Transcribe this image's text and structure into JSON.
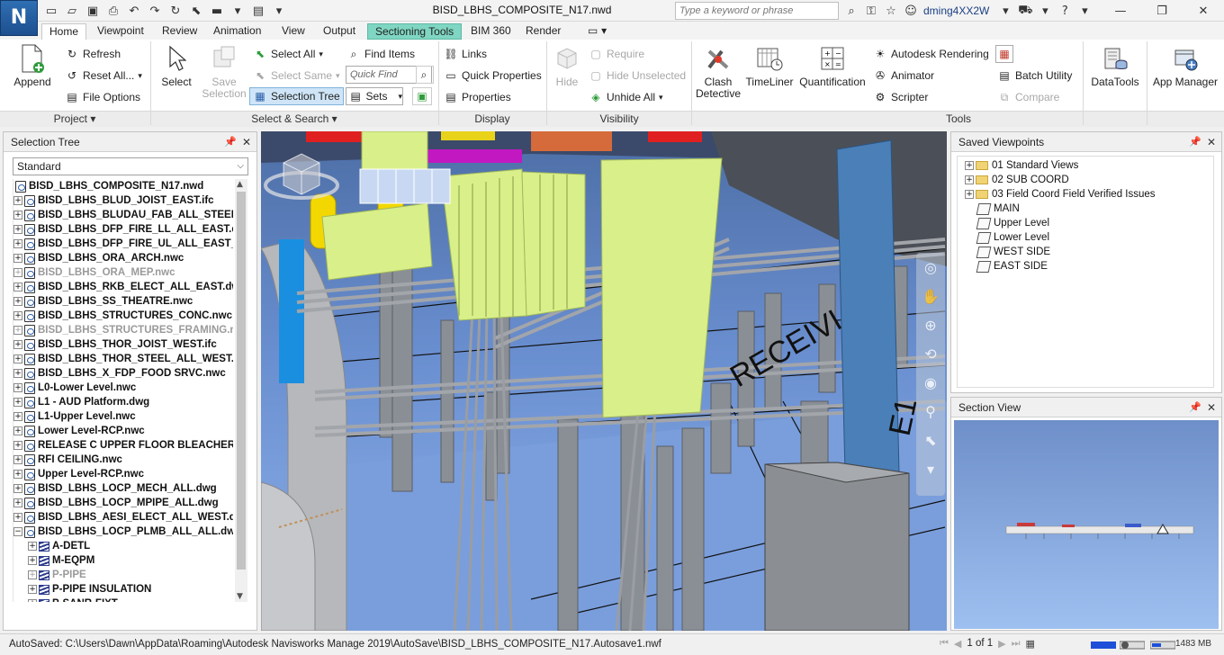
{
  "app": {
    "logo_letter": "N",
    "window_title": "BISD_LBHS_COMPOSITE_N17.nwd",
    "search_placeholder": "Type a keyword or phrase",
    "username": "dming4XX2W"
  },
  "ribbon_tabs": [
    "Home",
    "Viewpoint",
    "Review",
    "Animation",
    "View",
    "Output",
    "Sectioning Tools",
    "BIM 360",
    "Render"
  ],
  "active_tab": "Home",
  "ribbon": {
    "project": {
      "label": "Project",
      "append": "Append",
      "refresh": "Refresh",
      "reset_all": "Reset All...",
      "file_options": "File Options"
    },
    "select_search": {
      "label": "Select & Search",
      "select": "Select",
      "save_selection_1": "Save",
      "save_selection_2": "Selection",
      "select_all": "Select All",
      "select_same": "Select Same",
      "selection_tree": "Selection Tree",
      "find_items": "Find Items",
      "quick_find_placeholder": "Quick Find",
      "sets": "Sets"
    },
    "display": {
      "label": "Display",
      "links": "Links",
      "quick_properties": "Quick Properties",
      "properties": "Properties"
    },
    "visibility": {
      "label": "Visibility",
      "hide": "Hide",
      "require": "Require",
      "hide_unselected": "Hide Unselected",
      "unhide_all": "Unhide All"
    },
    "tools": {
      "label": "Tools",
      "clash_1": "Clash",
      "clash_2": "Detective",
      "timeliner": "TimeLiner",
      "quantification": "Quantification",
      "autodesk_rendering": "Autodesk Rendering",
      "animator": "Animator",
      "scripter": "Scripter",
      "batch_utility": "Batch Utility",
      "compare": "Compare"
    },
    "datatools": "DataTools",
    "app_manager": "App Manager"
  },
  "selection_tree": {
    "title": "Selection Tree",
    "mode": "Standard",
    "root": "BISD_LBHS_COMPOSITE_N17.nwd",
    "items": [
      {
        "label": "BISD_LBHS_BLUD_JOIST_EAST.ifc",
        "hidden": false
      },
      {
        "label": "BISD_LBHS_BLUDAU_FAB_ALL_STEEL_",
        "hidden": false
      },
      {
        "label": "BISD_LBHS_DFP_FIRE_LL_ALL_EAST.dv",
        "hidden": false
      },
      {
        "label": "BISD_LBHS_DFP_FIRE_UL_ALL_EAST_V",
        "hidden": false
      },
      {
        "label": "BISD_LBHS_ORA_ARCH.nwc",
        "hidden": false
      },
      {
        "label": "BISD_LBHS_ORA_MEP.nwc",
        "hidden": true
      },
      {
        "label": "BISD_LBHS_RKB_ELECT_ALL_EAST.dwg",
        "hidden": false
      },
      {
        "label": "BISD_LBHS_SS_THEATRE.nwc",
        "hidden": false
      },
      {
        "label": "BISD_LBHS_STRUCTURES_CONC.nwc",
        "hidden": false
      },
      {
        "label": "BISD_LBHS_STRUCTURES_FRAMING.nv",
        "hidden": true
      },
      {
        "label": "BISD_LBHS_THOR_JOIST_WEST.ifc",
        "hidden": false
      },
      {
        "label": "BISD_LBHS_THOR_STEEL_ALL_WEST.d",
        "hidden": false
      },
      {
        "label": "BISD_LBHS_X_FDP_FOOD SRVC.nwc",
        "hidden": false
      },
      {
        "label": "L0-Lower Level.nwc",
        "hidden": false
      },
      {
        "label": "L1 - AUD Platform.dwg",
        "hidden": false
      },
      {
        "label": "L1-Upper Level.nwc",
        "hidden": false
      },
      {
        "label": "Lower Level-RCP.nwc",
        "hidden": false
      },
      {
        "label": "RELEASE C UPPER FLOOR BLEACHER PLA",
        "hidden": false
      },
      {
        "label": "RFI CEILING.nwc",
        "hidden": false
      },
      {
        "label": "Upper Level-RCP.nwc",
        "hidden": false
      },
      {
        "label": "BISD_LBHS_LOCP_MECH_ALL.dwg",
        "hidden": false
      },
      {
        "label": "BISD_LBHS_LOCP_MPIPE_ALL.dwg",
        "hidden": false
      },
      {
        "label": "BISD_LBHS_AESI_ELECT_ALL_WEST.dw",
        "hidden": false
      },
      {
        "label": "BISD_LBHS_LOCP_PLMB_ALL_ALL.dwg",
        "hidden": false,
        "expanded": true
      }
    ],
    "layers": [
      {
        "label": "A-DETL",
        "hidden": false
      },
      {
        "label": "M-EQPM",
        "hidden": false
      },
      {
        "label": "P-PIPE",
        "hidden": true
      },
      {
        "label": "P-PIPE INSULATION",
        "hidden": false
      },
      {
        "label": "P-SANR-FIXT",
        "hidden": false
      }
    ]
  },
  "viewport": {
    "floor_text_1": "RECEIVI",
    "floor_text_2": "E1"
  },
  "saved_viewpoints": {
    "title": "Saved Viewpoints",
    "folders": [
      "01 Standard Views",
      "02 SUB COORD",
      "03 Field Coord Field Verified Issues"
    ],
    "views": [
      "MAIN",
      "Upper Level",
      "Lower Level",
      "WEST SIDE",
      "EAST SIDE"
    ]
  },
  "section_view": {
    "title": "Section View"
  },
  "statusbar": {
    "autosave": "AutoSaved: C:\\Users\\Dawn\\AppData\\Roaming\\Autodesk Navisworks Manage 2019\\AutoSave\\BISD_LBHS_COMPOSITE_N17.Autosave1.nwf",
    "page": "1 of 1",
    "memory": "1483 MB"
  },
  "colors": {
    "sky_top": "#4d6ea6",
    "sky_bottom": "#8eb1ea",
    "duct_green": "#d9f08a",
    "context_tab": "#7fd6c2",
    "selection_tree_pressed": "#cfe5f7"
  }
}
